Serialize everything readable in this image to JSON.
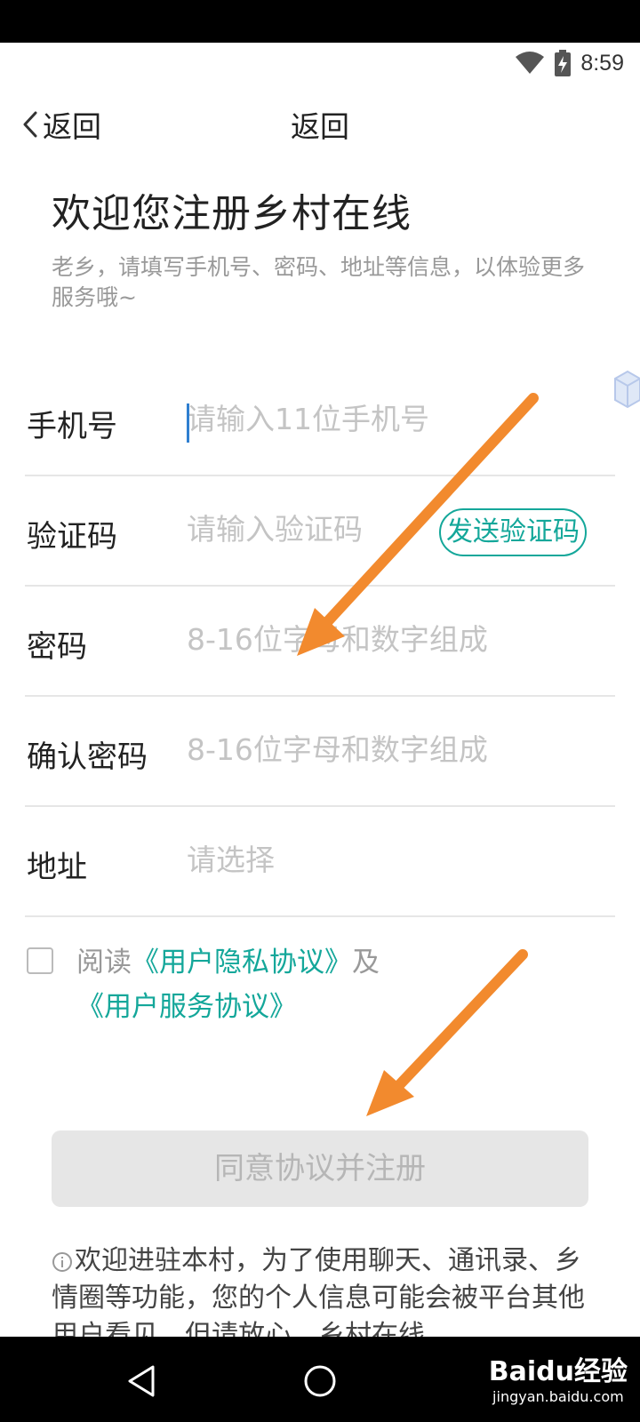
{
  "status_bar": {
    "time": "8:59"
  },
  "nav": {
    "back_label": "返回",
    "title": "返回"
  },
  "welcome": {
    "title": "欢迎您注册乡村在线",
    "subtitle": "老乡，请填写手机号、密码、地址等信息，以体验更多服务哦~"
  },
  "form": {
    "phone": {
      "label": "手机号",
      "placeholder": "请输入11位手机号"
    },
    "code": {
      "label": "验证码",
      "placeholder": "请输入验证码",
      "send_button": "发送验证码"
    },
    "password": {
      "label": "密码",
      "placeholder": "8-16位字母和数字组成"
    },
    "confirm_password": {
      "label": "确认密码",
      "placeholder": "8-16位字母和数字组成"
    },
    "address": {
      "label": "地址",
      "placeholder": "请选择"
    }
  },
  "agreement": {
    "prefix": "阅读",
    "privacy_link": "《用户隐私协议》",
    "and": "及",
    "service_link": "《用户服务协议》"
  },
  "register_button": "同意协议并注册",
  "notice": "欢迎进驻本村，为了使用聊天、通讯录、乡情圈等功能，您的个人信息可能会被平台其他用户看见，但请放心，乡村在线",
  "watermark": {
    "title": "Baidu经验",
    "url": "jingyan.baidu.com"
  },
  "colors": {
    "accent": "#14a79a",
    "arrow": "#f28a2e",
    "disabled_button": "#e6e6e6"
  }
}
